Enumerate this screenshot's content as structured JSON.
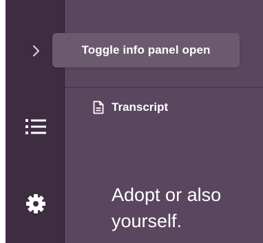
{
  "sidebar": {
    "toggle_icon": "chevron-right-icon",
    "list_icon": "list-icon",
    "settings_icon": "gear-icon"
  },
  "tooltip": {
    "text": "Toggle info panel open"
  },
  "transcript": {
    "heading": "Transcript",
    "icon": "document-icon",
    "text": "Adopt or also\nyourself."
  },
  "colors": {
    "sidebar_bg": "#3e2c41",
    "main_bg": "#5a465e",
    "tooltip_bg": "#6b5a6e",
    "text": "#ffffff"
  }
}
